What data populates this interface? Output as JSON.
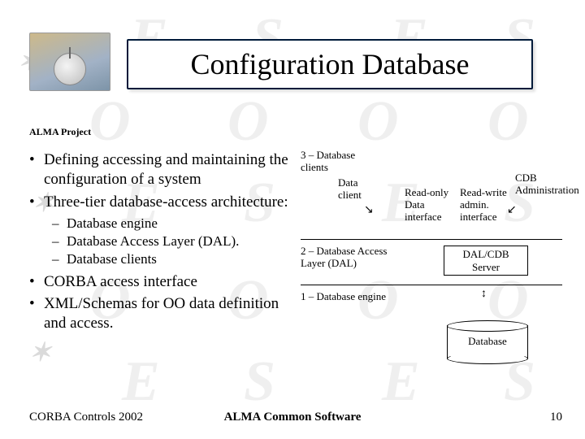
{
  "project_label": "ALMA Project",
  "title": "Configuration Database",
  "bullets": {
    "b1": "Defining accessing and maintaining the configuration of a system",
    "b2": "Three-tier database-access architecture:",
    "s1": "Database engine",
    "s2": "Database Access Layer (DAL).",
    "s3": "Database clients",
    "b3": "CORBA access interface",
    "b4": "XML/Schemas for OO data definition and access."
  },
  "diagram": {
    "tier3": "3 – Database clients",
    "data_client": "Data client",
    "readonly": "Read-only Data interface",
    "readwrite": "Read-write admin. interface",
    "cdbadmin": "CDB Administration",
    "tier2": "2 – Database Access Layer (DAL)",
    "dalserver": "DAL/CDB Server",
    "tier1": "1 – Database engine",
    "database": "Database"
  },
  "footer": {
    "left": "CORBA Controls 2002",
    "center": "ALMA Common Software",
    "page": "10"
  }
}
